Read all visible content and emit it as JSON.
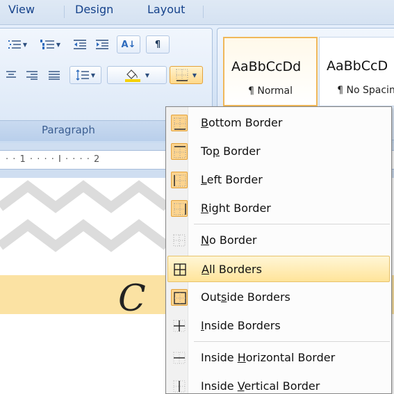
{
  "tabs": [
    {
      "label": "View"
    },
    {
      "label": "Design"
    },
    {
      "label": "Layout"
    }
  ],
  "ribbon": {
    "paragraph_group_label": "Paragraph",
    "sort_label": "A↓",
    "pilcrow_label": "¶"
  },
  "styles": [
    {
      "sample": "AaBbCcDd",
      "name": "¶ Normal",
      "selected": true
    },
    {
      "sample": "AaBbCcD",
      "name": "¶ No Spacin",
      "selected": false
    }
  ],
  "ruler": {
    "text": "· · 1 · · · · I · · · · 2"
  },
  "document": {
    "script_letter": "C"
  },
  "menu": {
    "items": [
      {
        "pre": "",
        "u": "B",
        "post": "ottom Border",
        "icon": "bottom-border-icon",
        "checked": true
      },
      {
        "pre": "To",
        "u": "p",
        "post": " Border",
        "icon": "top-border-icon",
        "checked": true
      },
      {
        "pre": "",
        "u": "L",
        "post": "eft Border",
        "icon": "left-border-icon",
        "checked": true
      },
      {
        "pre": "",
        "u": "R",
        "post": "ight Border",
        "icon": "right-border-icon",
        "checked": true
      },
      {
        "pre": "",
        "u": "N",
        "post": "o Border",
        "icon": "no-border-icon",
        "checked": false
      },
      {
        "pre": "",
        "u": "A",
        "post": "ll Borders",
        "icon": "all-borders-icon",
        "checked": false,
        "hover": true
      },
      {
        "pre": "Out",
        "u": "s",
        "post": "ide Borders",
        "icon": "outside-borders-icon",
        "checked": true
      },
      {
        "pre": "",
        "u": "I",
        "post": "nside Borders",
        "icon": "inside-borders-icon",
        "checked": false
      },
      {
        "pre": "Inside ",
        "u": "H",
        "post": "orizontal Border",
        "icon": "inside-horizontal-border-icon",
        "checked": false
      },
      {
        "pre": "Inside ",
        "u": "V",
        "post": "ertical Border",
        "icon": "inside-vertical-border-icon",
        "checked": false
      }
    ]
  },
  "colors": {
    "highlight": "#fbe2a3",
    "menu_hover": "#ffe49a",
    "ribbon": "#dbe7f6",
    "tab_text": "#15428b"
  }
}
